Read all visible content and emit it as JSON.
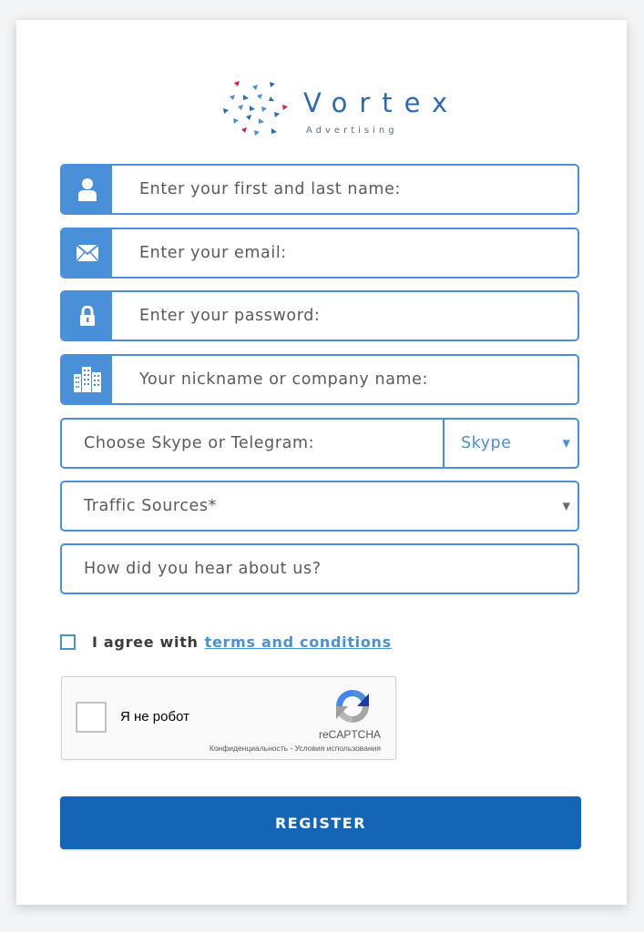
{
  "brand": {
    "name": "Vortex",
    "tagline": "Advertising",
    "colors": {
      "blue": "#2a6ab8",
      "pink": "#e0185f",
      "accent": "#4a90d9",
      "button": "#1565b7"
    }
  },
  "form": {
    "name_field": {
      "placeholder": "Enter your first and last name:",
      "icon": "user-icon"
    },
    "email_field": {
      "placeholder": "Enter your email:",
      "icon": "envelope-icon"
    },
    "password_field": {
      "placeholder": "Enter your password:",
      "icon": "lock-icon"
    },
    "nickname_field": {
      "placeholder": "Your nickname or company name:",
      "icon": "buildings-icon"
    },
    "messenger": {
      "placeholder": "Choose Skype or Telegram:",
      "selected": "Skype"
    },
    "traffic": {
      "placeholder": "Traffic Sources*"
    },
    "referral": {
      "placeholder": "How did you hear about us?"
    },
    "agree": {
      "label": "I agree with",
      "link": "terms and conditions"
    },
    "captcha": {
      "label": "Я не робот",
      "brand": "reCAPTCHA",
      "links": "Конфиденциальность - Условия использования"
    },
    "submit_label": "REGISTER"
  }
}
